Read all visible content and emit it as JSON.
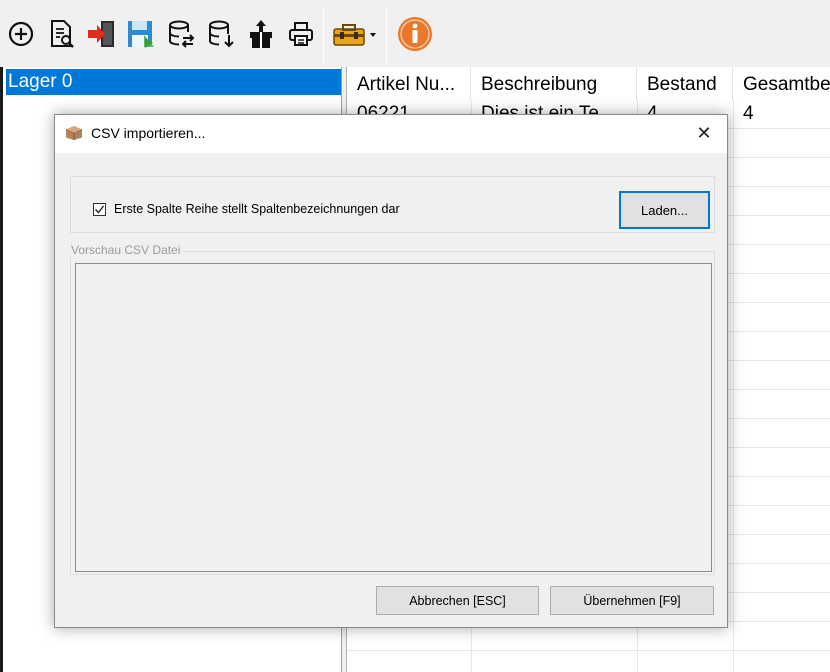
{
  "toolbar": {
    "icons": [
      "add-circle-icon",
      "document-search-icon",
      "exit-door-icon",
      "save-floppy-icon",
      "database-sync-icon",
      "database-download-icon",
      "package-up-icon",
      "printer-icon",
      "toolbox-dropdown-icon",
      "info-icon"
    ]
  },
  "tree": {
    "selected_item": "Lager 0"
  },
  "grid": {
    "columns": [
      "Artikel Nu...",
      "Beschreibung",
      "Bestand",
      "Gesamtbe"
    ],
    "rows": [
      [
        "06221",
        "Dies ist ein Te",
        "4",
        "4"
      ]
    ]
  },
  "dialog": {
    "title": "CSV importieren...",
    "close_symbol": "✕",
    "checkbox_checked": true,
    "checkbox_label": "Erste Spalte Reihe stellt Spaltenbezeichnungen dar",
    "load_button": "Laden...",
    "preview_legend": "Vorschau CSV Datei",
    "cancel_button": "Abbrechen [ESC]",
    "apply_button": "Übernehmen [F9]"
  },
  "colors": {
    "selection": "#0078d7",
    "info_icon": "#e8782c"
  }
}
